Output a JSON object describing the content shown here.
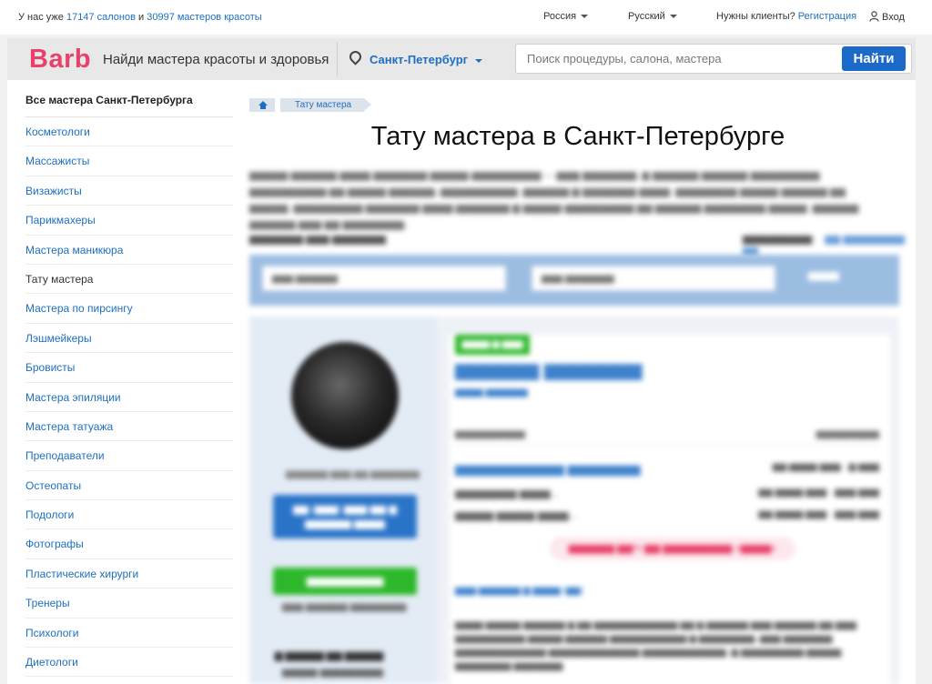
{
  "topbar": {
    "stats_prefix": "У нас уже",
    "salons_link": "17147 салонов",
    "stats_and": "и",
    "masters_link": "30997 мастеров красоты",
    "country": "Россия",
    "language": "Русский",
    "clients_text": "Нужны клиенты?",
    "register_link": "Регистрация",
    "login": "Вход"
  },
  "header": {
    "logo": "Barb",
    "tagline": "Найди мастера красоты и здоровья",
    "city": "Санкт-Петербург",
    "search_placeholder": "Поиск процедуры, салона, мастера",
    "search_button": "Найти"
  },
  "sidebar": {
    "title": "Все мастера Санкт-Петербурга",
    "items": [
      {
        "label": "Косметологи",
        "active": false
      },
      {
        "label": "Массажисты",
        "active": false
      },
      {
        "label": "Визажисты",
        "active": false
      },
      {
        "label": "Парикмахеры",
        "active": false
      },
      {
        "label": "Мастера маникюра",
        "active": false
      },
      {
        "label": "Тату мастера",
        "active": true
      },
      {
        "label": "Мастера по пирсингу",
        "active": false
      },
      {
        "label": "Лэшмейкеры",
        "active": false
      },
      {
        "label": "Бровисты",
        "active": false
      },
      {
        "label": "Мастера эпиляции",
        "active": false
      },
      {
        "label": "Мастера татуажа",
        "active": false
      },
      {
        "label": "Преподаватели",
        "active": false
      },
      {
        "label": "Остеопаты",
        "active": false
      },
      {
        "label": "Подологи",
        "active": false
      },
      {
        "label": "Фотографы",
        "active": false
      },
      {
        "label": "Пластические хирурги",
        "active": false
      },
      {
        "label": "Тренеры",
        "active": false
      },
      {
        "label": "Психологи",
        "active": false
      },
      {
        "label": "Диетологи",
        "active": false
      }
    ]
  },
  "main": {
    "breadcrumb": "Тату мастера",
    "title": "Тату мастера в Санкт-Петербурге"
  },
  "colors": {
    "brand": "#e8416a",
    "link": "#1e6fc1",
    "button": "#1b6ac9",
    "green": "#2db82b",
    "filter_bar": "#9cbde2"
  }
}
